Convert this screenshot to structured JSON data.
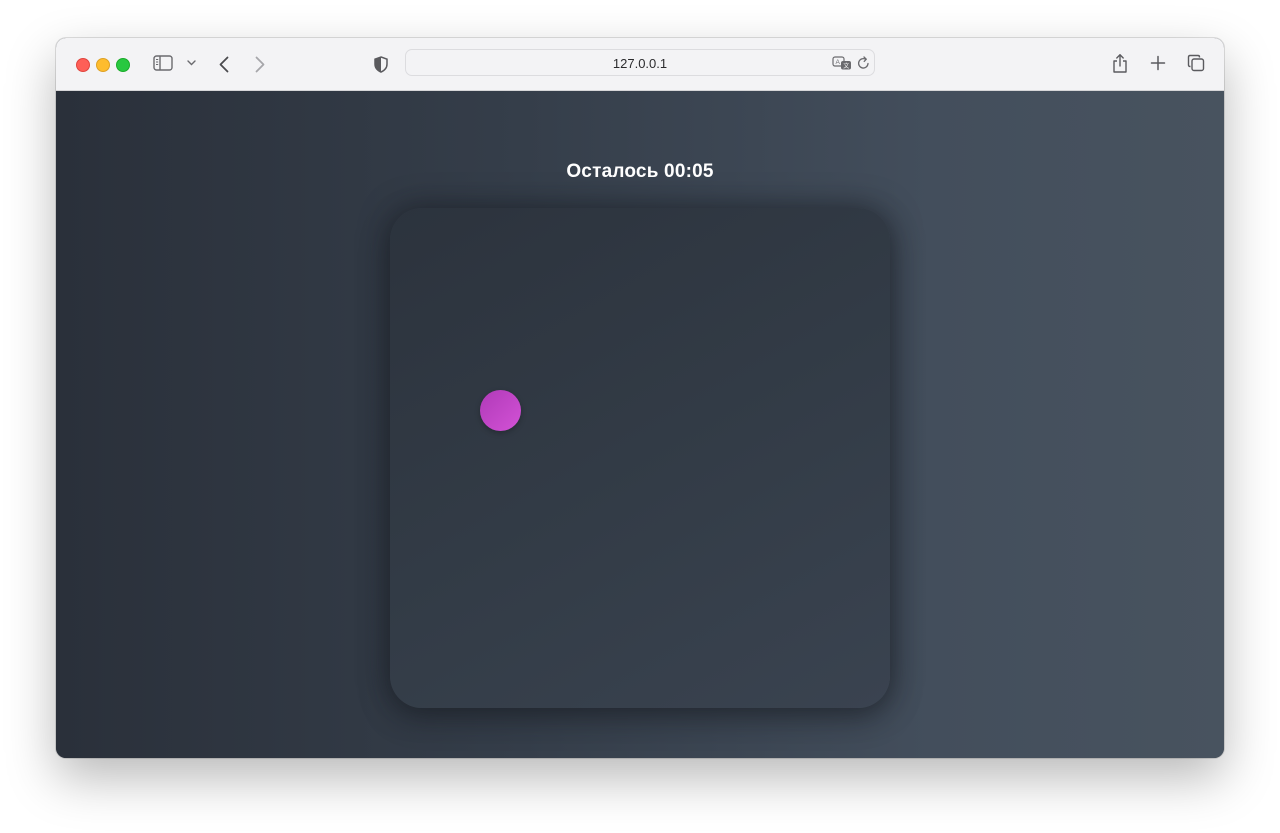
{
  "browser": {
    "url": "127.0.0.1",
    "icons": {
      "sidebar": "sidebar-icon",
      "chevron": "chevron-down-icon",
      "back": "back-arrow-icon",
      "forward": "forward-arrow-icon",
      "privacy": "shield-icon",
      "translate": "translate-icon",
      "reload": "reload-icon",
      "share": "share-icon",
      "new_tab": "plus-icon",
      "tabs": "tab-overview-icon"
    }
  },
  "game": {
    "timer_text": "Осталось 00:05",
    "target_color": "#c748cc"
  }
}
